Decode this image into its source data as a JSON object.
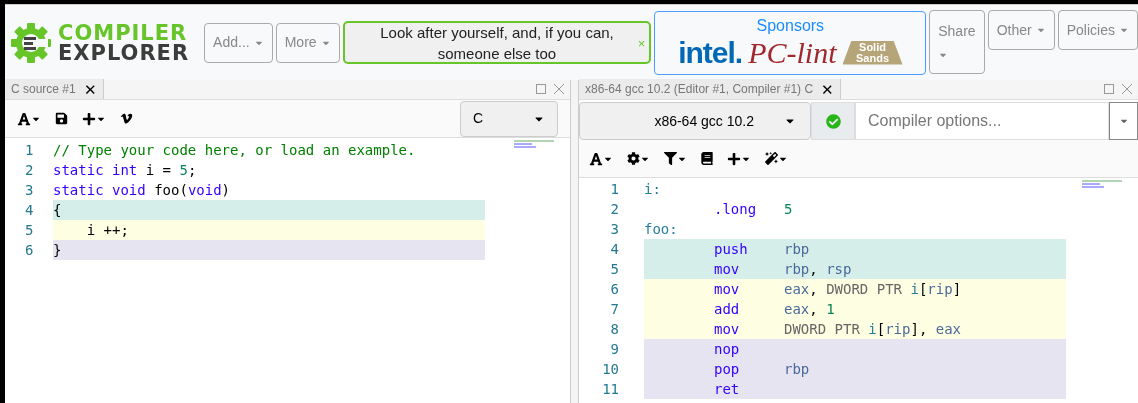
{
  "header": {
    "logo": {
      "line1": "COMPILER",
      "line2": "EXPLORER"
    },
    "menus": [
      {
        "label": "Add..."
      },
      {
        "label": "More"
      }
    ],
    "notice": {
      "text": "Look after yourself, and, if you can, someone else too",
      "close": "×"
    },
    "sponsors": {
      "title": "Sponsors",
      "logos": [
        {
          "text": "intel."
        },
        {
          "text": "PC-lint"
        },
        {
          "text": "Solid Sands"
        }
      ]
    },
    "right_menus": [
      {
        "label": "Share"
      },
      {
        "label": "Other"
      },
      {
        "label": "Policies"
      }
    ]
  },
  "source_pane": {
    "tab": {
      "title": "C source #1",
      "close": "✕",
      "selected": true
    },
    "language": "C",
    "lines": [
      {
        "n": "1",
        "tokens": [
          {
            "t": "// Type your code here, or load an example.",
            "kind": "comment"
          }
        ]
      },
      {
        "n": "2",
        "tokens": [
          {
            "t": "static int",
            "kind": "keyword"
          },
          {
            "t": " i = ",
            "kind": "plain"
          },
          {
            "t": "5",
            "kind": "number"
          },
          {
            "t": ";",
            "kind": "plain"
          }
        ]
      },
      {
        "n": "3",
        "tokens": [
          {
            "t": "static void",
            "kind": "keyword"
          },
          {
            "t": " foo(",
            "kind": "plain"
          },
          {
            "t": "void",
            "kind": "keyword"
          },
          {
            "t": ")",
            "kind": "plain"
          }
        ]
      },
      {
        "n": "4",
        "color": "#d5eeea",
        "tokens": [
          {
            "t": "{",
            "kind": "plain"
          }
        ]
      },
      {
        "n": "5",
        "color": "#fefee2",
        "tokens": [
          {
            "t": "    i ++;",
            "kind": "plain"
          }
        ]
      },
      {
        "n": "6",
        "color": "#e6e4f1",
        "tokens": [
          {
            "t": "}",
            "kind": "plain"
          }
        ]
      }
    ]
  },
  "compiler_pane": {
    "tab": {
      "title": "x86-64 gcc 10.2 (Editor #1, Compiler #1) C",
      "close": "✕",
      "selected": true
    },
    "compiler": "x86-64 gcc 10.2",
    "status_ok": true,
    "options": {
      "placeholder": "Compiler options..."
    },
    "lines": [
      {
        "n": "1",
        "label": "i:"
      },
      {
        "n": "2",
        "op": ".long",
        "args": [
          {
            "t": "5",
            "kind": "number"
          }
        ]
      },
      {
        "n": "3",
        "label": "foo:"
      },
      {
        "n": "4",
        "color": "#d5eeea",
        "op": "push",
        "args": [
          {
            "t": "rbp",
            "kind": "reg"
          }
        ]
      },
      {
        "n": "5",
        "color": "#d5eeea",
        "op": "mov",
        "args": [
          {
            "t": "rbp",
            "kind": "reg"
          },
          {
            "t": ", ",
            "kind": "plain"
          },
          {
            "t": "rsp",
            "kind": "reg"
          }
        ]
      },
      {
        "n": "6",
        "color": "#fefee2",
        "op": "mov",
        "args": [
          {
            "t": "eax",
            "kind": "reg"
          },
          {
            "t": ", ",
            "kind": "plain"
          },
          {
            "t": "DWORD PTR ",
            "kind": "gray"
          },
          {
            "t": "i",
            "kind": "label"
          },
          {
            "t": "[",
            "kind": "plain"
          },
          {
            "t": "rip",
            "kind": "reg"
          },
          {
            "t": "]",
            "kind": "plain"
          }
        ]
      },
      {
        "n": "7",
        "color": "#fefee2",
        "op": "add",
        "args": [
          {
            "t": "eax",
            "kind": "reg"
          },
          {
            "t": ", ",
            "kind": "plain"
          },
          {
            "t": "1",
            "kind": "number"
          }
        ]
      },
      {
        "n": "8",
        "color": "#fefee2",
        "op": "mov",
        "args": [
          {
            "t": "DWORD PTR ",
            "kind": "gray"
          },
          {
            "t": "i",
            "kind": "label"
          },
          {
            "t": "[",
            "kind": "plain"
          },
          {
            "t": "rip",
            "kind": "reg"
          },
          {
            "t": "], ",
            "kind": "plain"
          },
          {
            "t": "eax",
            "kind": "reg"
          }
        ]
      },
      {
        "n": "9",
        "color": "#e6e4f1",
        "op": "nop"
      },
      {
        "n": "10",
        "color": "#e6e4f1",
        "op": "pop",
        "args": [
          {
            "t": "rbp",
            "kind": "reg"
          }
        ]
      },
      {
        "n": "11",
        "color": "#e6e4f1",
        "op": "ret"
      }
    ]
  }
}
